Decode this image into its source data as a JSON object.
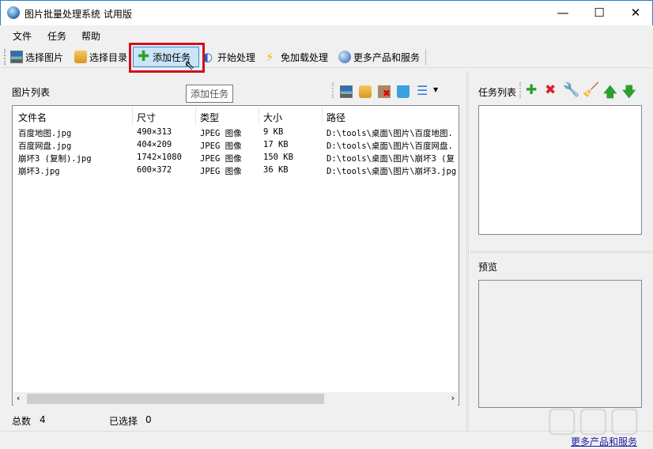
{
  "window": {
    "title": "图片批量处理系统 试用版",
    "minimize": "—",
    "maximize": "☐",
    "close": "✕"
  },
  "menu": [
    "文件",
    "任务",
    "帮助"
  ],
  "toolbar": {
    "select_image": "选择图片",
    "select_dir": "选择目录",
    "add_task": "添加任务",
    "start": "开始处理",
    "no_load": "免加载处理",
    "more": "更多产品和服务"
  },
  "tooltip": "添加任务",
  "image_list": {
    "label": "图片列表",
    "columns": [
      "文件名",
      "尺寸",
      "类型",
      "大小",
      "路径"
    ],
    "rows": [
      [
        "百度地图.jpg",
        "490×313",
        "JPEG 图像",
        "9 KB",
        "D:\\tools\\桌面\\图片\\百度地图."
      ],
      [
        "百度网盘.jpg",
        "404×209",
        "JPEG 图像",
        "17 KB",
        "D:\\tools\\桌面\\图片\\百度网盘."
      ],
      [
        "崩坏3 (复制).jpg",
        "1742×1080",
        "JPEG 图像",
        "150 KB",
        "D:\\tools\\桌面\\图片\\崩坏3 (复"
      ],
      [
        "崩坏3.jpg",
        "600×372",
        "JPEG 图像",
        "36 KB",
        "D:\\tools\\桌面\\图片\\崩坏3.jpg"
      ]
    ]
  },
  "status": {
    "total_label": "总数",
    "total": "4",
    "selected_label": "已选择",
    "selected": "0"
  },
  "task_list": {
    "label": "任务列表"
  },
  "preview": {
    "label": "预览"
  },
  "footer_link": "更多产品和服务",
  "watermark": "下载吧"
}
